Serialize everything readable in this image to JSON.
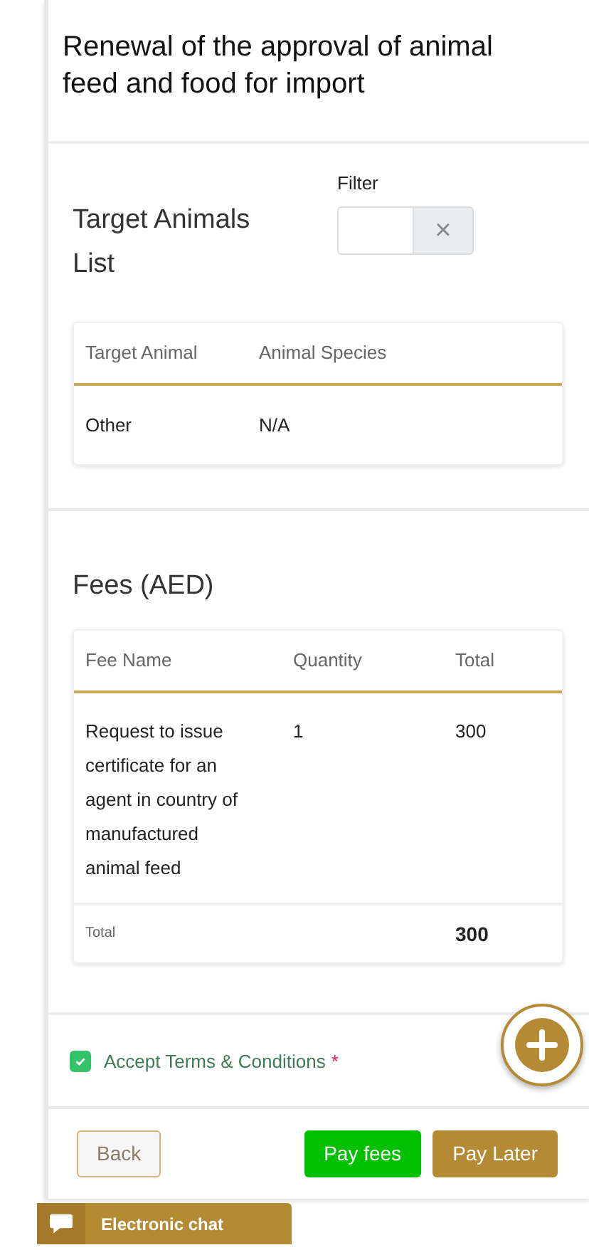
{
  "request_title": "Renewal of the approval of animal feed and food for import",
  "target_animals": {
    "title": "Target Animals List",
    "filter": {
      "label": "Filter",
      "clear": "×"
    },
    "table": {
      "columns": [
        "Target Animal",
        "Animal Species"
      ],
      "rows": [
        [
          "Other",
          "N/A"
        ]
      ]
    }
  },
  "fees": {
    "title": "Fees (AED)",
    "table": {
      "columns": [
        "Fee Name",
        "Quantity",
        "Total"
      ],
      "rows": [
        [
          "Request to issue certificate for an agent in country of manufactured animal feed",
          "1",
          "300"
        ]
      ],
      "footer": {
        "label": "Total",
        "total": "300"
      }
    }
  },
  "terms": {
    "label": "Accept Terms & Conditions",
    "required_mark": "*",
    "checked": true
  },
  "buttons": [
    {
      "label": "Back",
      "kind": "outline"
    },
    {
      "label": "Pay fees",
      "kind": "success"
    },
    {
      "label": "Pay Later",
      "kind": "primary"
    }
  ],
  "chat": {
    "label": "Electronic chat"
  }
}
